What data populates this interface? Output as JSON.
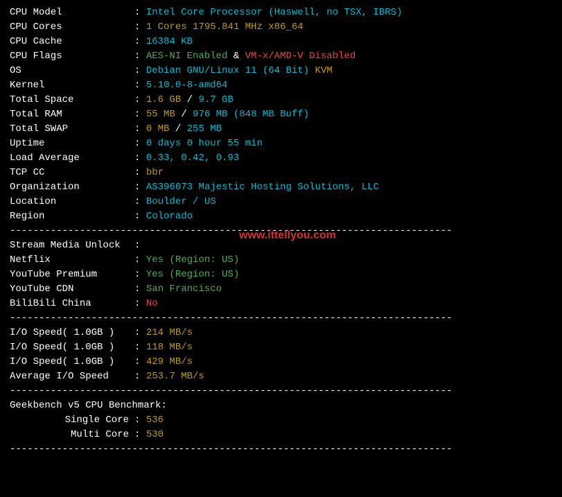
{
  "divider": "----------------------------------------------------------------------------",
  "watermark": "www.ittellyou.com",
  "sys": {
    "cpu_model": {
      "label": "CPU Model",
      "value": "Intel Core Processor (Haswell, no TSX, IBRS)"
    },
    "cpu_cores": {
      "label": "CPU Cores",
      "value": "1 Cores 1795.841 MHz x86_64"
    },
    "cpu_cache": {
      "label": "CPU Cache",
      "value": "16384 KB"
    },
    "cpu_flags": {
      "label": "CPU Flags",
      "aes": "AES-NI Enabled",
      "amp": " & ",
      "vmx": "VM-x/AMD-V Disabled"
    },
    "os": {
      "label": "OS",
      "distro": "Debian GNU/Linux 11 (64 Bit) ",
      "virt": "KVM"
    },
    "kernel": {
      "label": "Kernel",
      "value": "5.10.0-8-amd64"
    },
    "total_space": {
      "label": "Total Space",
      "used": "1.6 GB",
      "sep": " / ",
      "total": "9.7 GB"
    },
    "total_ram": {
      "label": "Total RAM",
      "used": "55 MB",
      "sep": " / ",
      "total": "976 MB ",
      "buff": "(848 MB Buff)"
    },
    "total_swap": {
      "label": "Total SWAP",
      "used": "0 MB",
      "sep": " / ",
      "total": "255 MB"
    },
    "uptime": {
      "label": "Uptime",
      "value": "0 days 0 hour 55 min"
    },
    "load_avg": {
      "label": "Load Average",
      "value": "0.33, 0.42, 0.93"
    },
    "tcp_cc": {
      "label": "TCP CC",
      "value": "bbr"
    },
    "org": {
      "label": "Organization",
      "value": "AS396073 Majestic Hosting Solutions, LLC"
    },
    "location": {
      "label": "Location",
      "value": "Boulder / US"
    },
    "region": {
      "label": "Region",
      "value": "Colorado"
    }
  },
  "stream": {
    "header": "Stream Media Unlock",
    "netflix": {
      "label": "Netflix",
      "value": "Yes (Region: US)"
    },
    "youtube_premium": {
      "label": "YouTube Premium",
      "value": "Yes (Region: US)"
    },
    "youtube_cdn": {
      "label": "YouTube CDN",
      "value": "San Francisco"
    },
    "bilibili": {
      "label": "BiliBili China",
      "value": "No"
    }
  },
  "io": {
    "t1": {
      "label": "I/O Speed( 1.0GB )",
      "value": "214 MB/s"
    },
    "t2": {
      "label": "I/O Speed( 1.0GB )",
      "value": "118 MB/s"
    },
    "t3": {
      "label": "I/O Speed( 1.0GB )",
      "value": "429 MB/s"
    },
    "avg": {
      "label": "Average I/O Speed",
      "value": "253.7 MB/s"
    }
  },
  "geekbench": {
    "header": "Geekbench v5 CPU Benchmark:",
    "single": {
      "label": "Single Core",
      "value": "536"
    },
    "multi": {
      "label": "Multi Core",
      "value": "530"
    }
  }
}
